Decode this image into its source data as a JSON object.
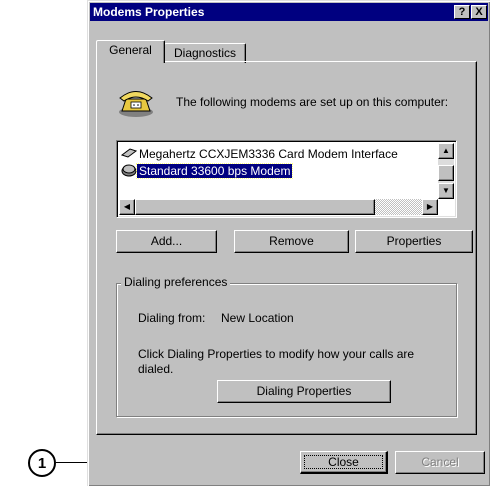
{
  "callout": {
    "number": "1"
  },
  "window": {
    "title": "Modems Properties",
    "help_button": "?",
    "close_button": "X"
  },
  "tabs": [
    {
      "label": "General",
      "active": true
    },
    {
      "label": "Diagnostics",
      "active": false
    }
  ],
  "general": {
    "intro_text": "The following modems are set up on this computer:",
    "modems": [
      {
        "name": "Megahertz CCXJEM3336 Card Modem Interface",
        "selected": false
      },
      {
        "name": "Standard 33600 bps Modem",
        "selected": true
      }
    ],
    "buttons": {
      "add": "Add...",
      "remove": "Remove",
      "properties": "Properties"
    },
    "dialing_group": {
      "legend": "Dialing preferences",
      "dialing_from_label": "Dialing from:",
      "dialing_from_value": "New Location",
      "help_line1": "Click Dialing Properties to modify how your calls are",
      "help_line2": "dialed.",
      "dialing_properties_button": "Dialing Properties"
    }
  },
  "footer": {
    "close": "Close",
    "cancel": "Cancel"
  },
  "colors": {
    "titlebar": "#000080",
    "face": "#c0c0c0",
    "selection": "#000080"
  }
}
